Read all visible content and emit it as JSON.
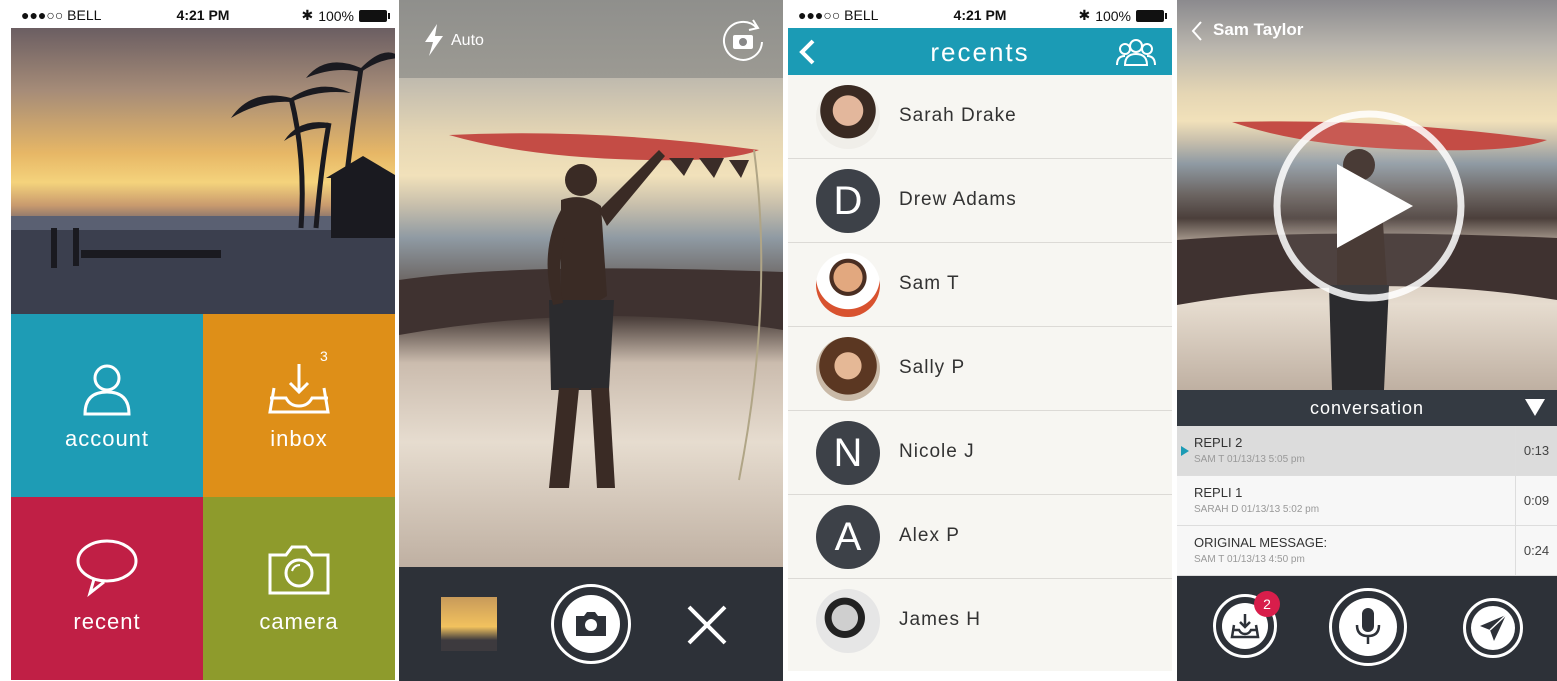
{
  "status_bar": {
    "carrier": "●●●○○ BELL",
    "time": "4:21 PM",
    "battery": "100%"
  },
  "home": {
    "tiles": [
      {
        "label": "account",
        "color": "#1e9cb5",
        "icon": "person-icon"
      },
      {
        "label": "inbox",
        "color": "#de8f18",
        "icon": "inbox-download-icon",
        "badge": "3"
      },
      {
        "label": "recent",
        "color": "#c01f45",
        "icon": "speech-bubble-icon"
      },
      {
        "label": "camera",
        "color": "#8e9b2c",
        "icon": "camera-icon"
      }
    ]
  },
  "camera": {
    "flash_label": "Auto",
    "flash_icon": "lightning-icon",
    "switch_icon": "camera-switch-icon",
    "shutter_icon": "camera-icon",
    "close_icon": "close-icon"
  },
  "recents": {
    "title": "recents",
    "back_icon": "chevron-left-icon",
    "group_icon": "group-icon",
    "contacts": [
      {
        "name": "Sarah Drake",
        "initial": "",
        "photo": "#b77a5c"
      },
      {
        "name": "Drew Adams",
        "initial": "D",
        "photo": ""
      },
      {
        "name": "Sam T",
        "initial": "",
        "photo": "#d8522f"
      },
      {
        "name": "Sally P",
        "initial": "",
        "photo": "#a0704f"
      },
      {
        "name": "Nicole J",
        "initial": "N",
        "photo": ""
      },
      {
        "name": "Alex P",
        "initial": "A",
        "photo": ""
      },
      {
        "name": "James H",
        "initial": "",
        "photo": "#777777"
      }
    ]
  },
  "conversation": {
    "back_label": "Sam Taylor",
    "header": "conversation",
    "collapse_icon": "triangle-down-icon",
    "play_icon": "play-icon",
    "messages": [
      {
        "title": "REPLI 2",
        "sub": "SAM T 01/13/13 5:05 pm",
        "duration": "0:13",
        "active": true
      },
      {
        "title": "REPLI 1",
        "sub": "SARAH D 01/13/13 5:02 pm",
        "duration": "0:09",
        "active": false
      },
      {
        "title": "ORIGINAL MESSAGE:",
        "sub": "SAM T 01/13/13 4:50 pm",
        "duration": "0:24",
        "active": false
      }
    ],
    "inbox_badge": "2",
    "inbox_icon": "inbox-download-icon",
    "mic_icon": "microphone-icon",
    "send_icon": "paper-plane-icon"
  }
}
